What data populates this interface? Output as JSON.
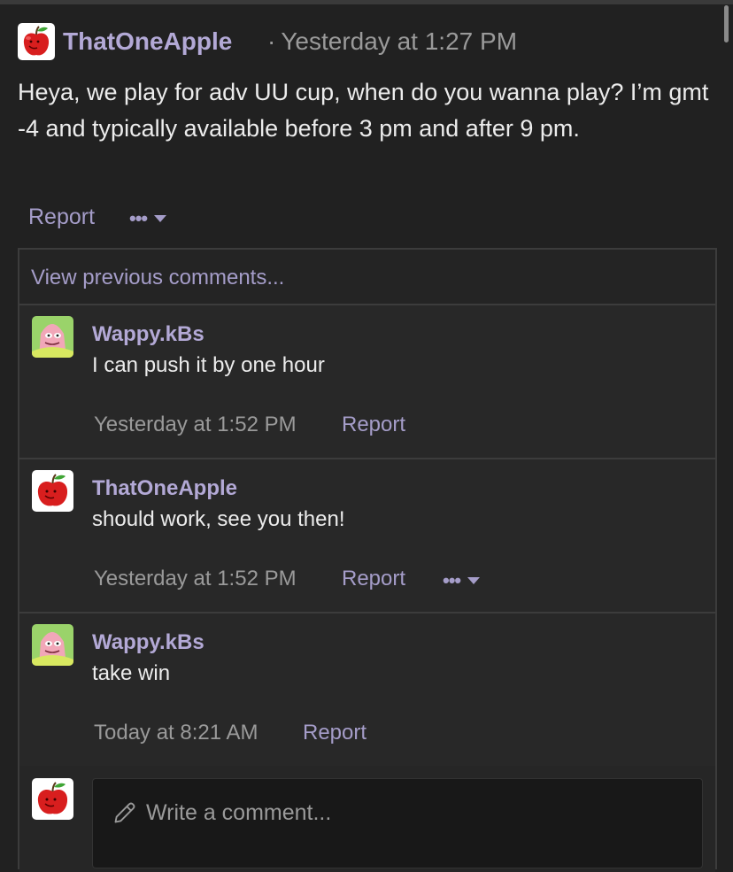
{
  "colors": {
    "background": "#212121",
    "author": "#b3a9d6",
    "link": "#a59dc9",
    "meta": "#9a9a9a"
  },
  "post": {
    "author": "ThatOneApple",
    "separator": "·",
    "timestamp": "Yesterday at 1:27 PM",
    "body": "Heya, we play for adv UU cup, when do you wanna play? I’m gmt -4 and typically available before 3 pm and after 9 pm.",
    "report_label": "Report",
    "more_label": "•••",
    "avatar_icon": "apple-avatar-icon"
  },
  "thread": {
    "view_previous": "View previous comments...",
    "comments": [
      {
        "author": "Wappy.kBs",
        "text": "I can push it by one hour",
        "time": "Yesterday at 1:52 PM",
        "report": "Report",
        "avatar_icon": "patrick-avatar-icon"
      },
      {
        "author": "ThatOneApple",
        "text": "should work, see you then!",
        "time": "Yesterday at 1:52 PM",
        "report": "Report",
        "more": "•••",
        "avatar_icon": "apple-avatar-icon"
      },
      {
        "author": "Wappy.kBs",
        "text": "take win",
        "time": "Today at 8:21 AM",
        "report": "Report",
        "avatar_icon": "patrick-avatar-icon"
      }
    ]
  },
  "composer": {
    "placeholder": "Write a comment...",
    "icon": "pencil-icon"
  }
}
